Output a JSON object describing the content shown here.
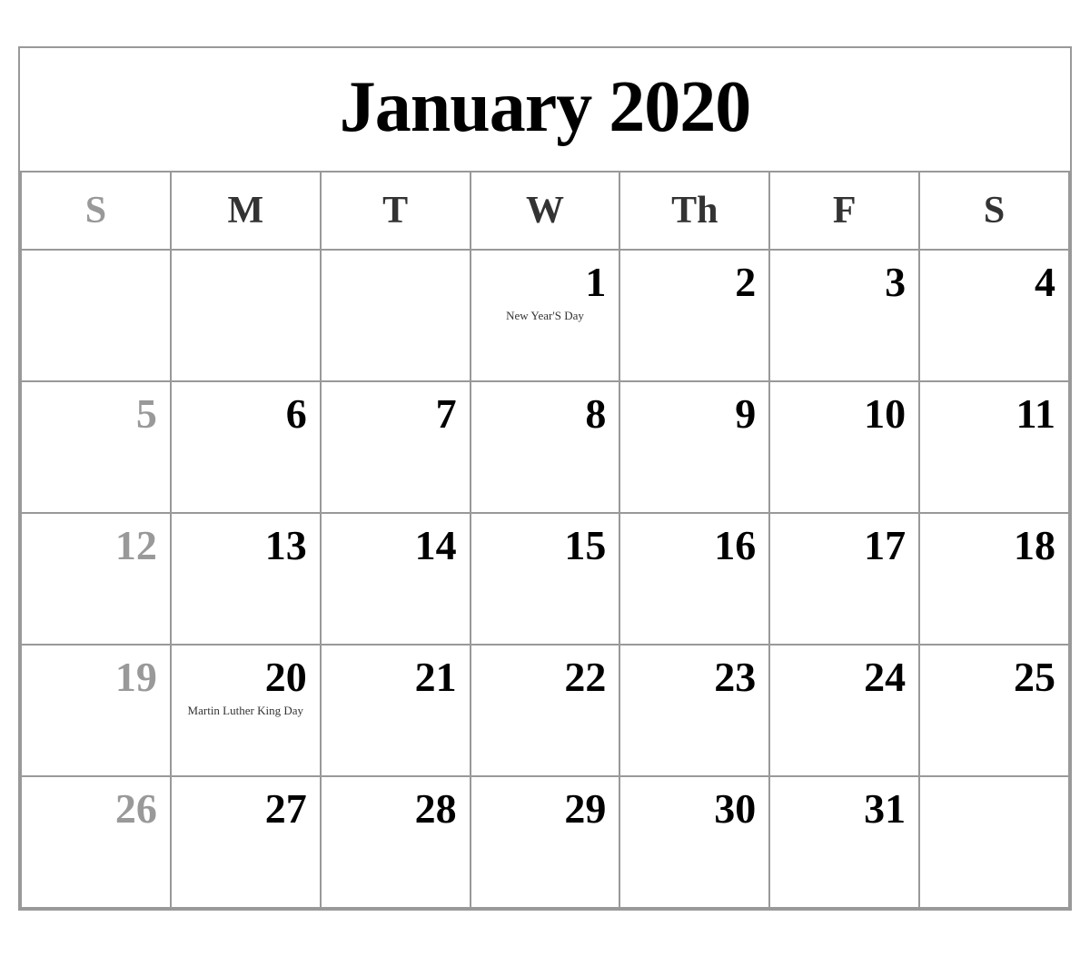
{
  "calendar": {
    "title": "January 2020",
    "headers": [
      {
        "label": "S",
        "is_sunday": true
      },
      {
        "label": "M",
        "is_sunday": false
      },
      {
        "label": "T",
        "is_sunday": false
      },
      {
        "label": "W",
        "is_sunday": false
      },
      {
        "label": "Th",
        "is_sunday": false
      },
      {
        "label": "F",
        "is_sunday": false
      },
      {
        "label": "S",
        "is_sunday": false
      }
    ],
    "weeks": [
      [
        {
          "day": "",
          "empty": true,
          "sunday": true
        },
        {
          "day": "",
          "empty": true,
          "sunday": false
        },
        {
          "day": "",
          "empty": true,
          "sunday": false
        },
        {
          "day": "1",
          "empty": false,
          "sunday": false,
          "holiday": "New Year'S Day"
        },
        {
          "day": "2",
          "empty": false,
          "sunday": false
        },
        {
          "day": "3",
          "empty": false,
          "sunday": false
        },
        {
          "day": "4",
          "empty": false,
          "sunday": false
        }
      ],
      [
        {
          "day": "5",
          "empty": false,
          "sunday": true
        },
        {
          "day": "6",
          "empty": false,
          "sunday": false
        },
        {
          "day": "7",
          "empty": false,
          "sunday": false
        },
        {
          "day": "8",
          "empty": false,
          "sunday": false
        },
        {
          "day": "9",
          "empty": false,
          "sunday": false
        },
        {
          "day": "10",
          "empty": false,
          "sunday": false
        },
        {
          "day": "11",
          "empty": false,
          "sunday": false
        }
      ],
      [
        {
          "day": "12",
          "empty": false,
          "sunday": true
        },
        {
          "day": "13",
          "empty": false,
          "sunday": false
        },
        {
          "day": "14",
          "empty": false,
          "sunday": false
        },
        {
          "day": "15",
          "empty": false,
          "sunday": false
        },
        {
          "day": "16",
          "empty": false,
          "sunday": false
        },
        {
          "day": "17",
          "empty": false,
          "sunday": false
        },
        {
          "day": "18",
          "empty": false,
          "sunday": false
        }
      ],
      [
        {
          "day": "19",
          "empty": false,
          "sunday": true
        },
        {
          "day": "20",
          "empty": false,
          "sunday": false,
          "holiday": "Martin Luther King Day"
        },
        {
          "day": "21",
          "empty": false,
          "sunday": false
        },
        {
          "day": "22",
          "empty": false,
          "sunday": false
        },
        {
          "day": "23",
          "empty": false,
          "sunday": false
        },
        {
          "day": "24",
          "empty": false,
          "sunday": false
        },
        {
          "day": "25",
          "empty": false,
          "sunday": false
        }
      ],
      [
        {
          "day": "26",
          "empty": false,
          "sunday": true
        },
        {
          "day": "27",
          "empty": false,
          "sunday": false
        },
        {
          "day": "28",
          "empty": false,
          "sunday": false
        },
        {
          "day": "29",
          "empty": false,
          "sunday": false
        },
        {
          "day": "30",
          "empty": false,
          "sunday": false
        },
        {
          "day": "31",
          "empty": false,
          "sunday": false
        },
        {
          "day": "",
          "empty": true,
          "sunday": false
        }
      ]
    ]
  }
}
